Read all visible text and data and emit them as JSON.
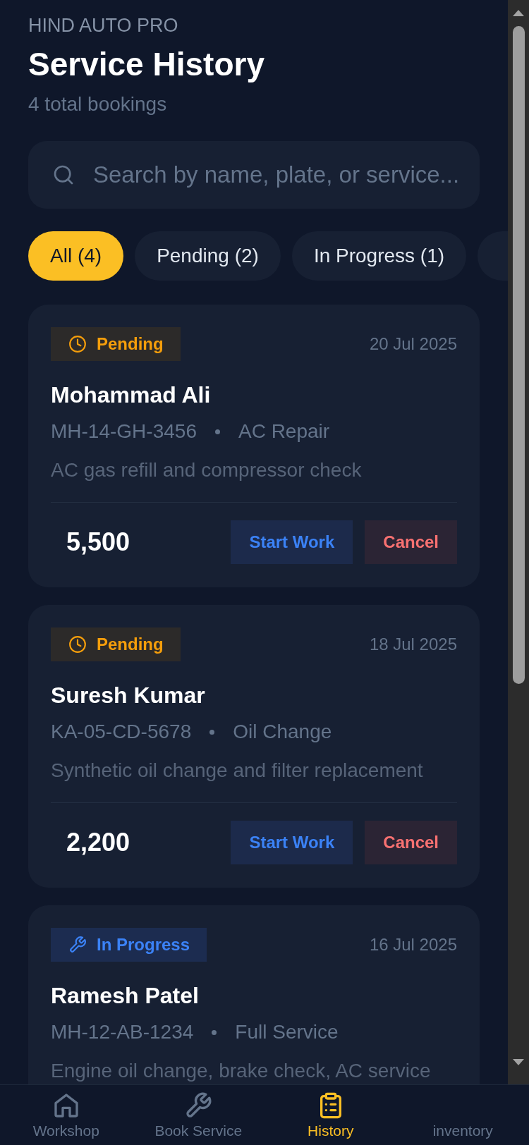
{
  "header": {
    "brand": "HIND AUTO PRO",
    "title": "Service History",
    "subtitle": "4 total bookings"
  },
  "search": {
    "placeholder": "Search by name, plate, or service..."
  },
  "filters": [
    {
      "label": "All (4)",
      "selected": true
    },
    {
      "label": "Pending (2)",
      "selected": false
    },
    {
      "label": "In Progress (1)",
      "selected": false
    },
    {
      "selected": false
    }
  ],
  "bookings": [
    {
      "status": {
        "kind": "pending",
        "label": "Pending"
      },
      "date": "20 Jul 2025",
      "customer": "Mohammad Ali",
      "plate": "MH-14-GH-3456",
      "service": "AC Repair",
      "description": "AC gas refill and compressor check",
      "price": "5,500",
      "actions": [
        {
          "kind": "start",
          "label": "Start Work"
        },
        {
          "kind": "cancel",
          "label": "Cancel"
        }
      ]
    },
    {
      "status": {
        "kind": "pending",
        "label": "Pending"
      },
      "date": "18 Jul 2025",
      "customer": "Suresh Kumar",
      "plate": "KA-05-CD-5678",
      "service": "Oil Change",
      "description": "Synthetic oil change and filter replacement",
      "price": "2,200",
      "actions": [
        {
          "kind": "start",
          "label": "Start Work"
        },
        {
          "kind": "cancel",
          "label": "Cancel"
        }
      ]
    },
    {
      "status": {
        "kind": "in_progress",
        "label": "In Progress"
      },
      "date": "16 Jul 2025",
      "customer": "Ramesh Patel",
      "plate": "MH-12-AB-1234",
      "service": "Full Service",
      "description": "Engine oil change, brake check, AC service"
    }
  ],
  "nav": [
    {
      "label": "Workshop",
      "selected": false
    },
    {
      "label": "Book Service",
      "selected": false
    },
    {
      "label": "History",
      "selected": true
    },
    {
      "label": "inventory",
      "selected": false
    }
  ]
}
